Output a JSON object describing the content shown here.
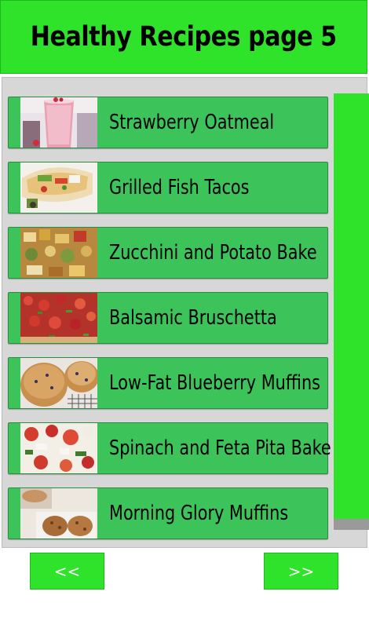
{
  "header": {
    "title": "Healthy Recipes page 5",
    "background_color": "#2ee32a"
  },
  "recipes": [
    {
      "label": "Strawberry Oatmeal",
      "thumbnail": "strawberry-smoothie-image"
    },
    {
      "label": "Grilled Fish Tacos",
      "thumbnail": "fish-tacos-image"
    },
    {
      "label": "Zucchini and Potato Bake",
      "thumbnail": "zucchini-potato-bake-image"
    },
    {
      "label": "Balsamic Bruschetta",
      "thumbnail": "bruschetta-image"
    },
    {
      "label": "Low-Fat Blueberry Muffins",
      "thumbnail": "blueberry-muffins-image"
    },
    {
      "label": "Spinach and Feta Pita Bake",
      "thumbnail": "spinach-feta-pita-image"
    },
    {
      "label": "Morning Glory Muffins",
      "thumbnail": "morning-glory-muffins-image"
    }
  ],
  "navigation": {
    "prev_label": "<<",
    "next_label": ">>"
  },
  "colors": {
    "item_background": "#3cc45a",
    "scrollbar": "#2ee32a",
    "panel_background": "#d7d7d7"
  }
}
